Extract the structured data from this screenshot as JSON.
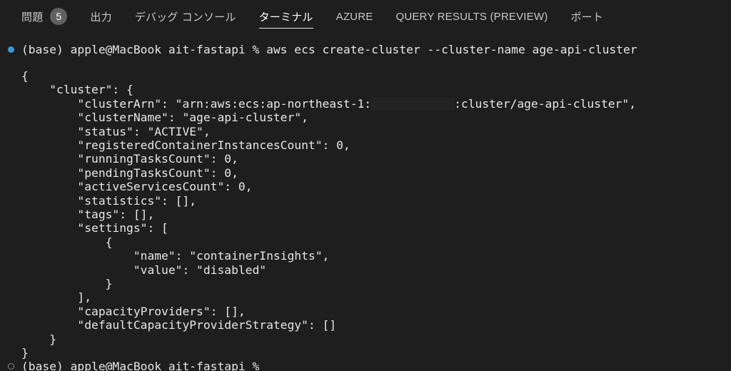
{
  "panel_tabs": [
    {
      "label": "問題",
      "badge": "5"
    },
    {
      "label": "出力"
    },
    {
      "label": "デバッグ コンソール"
    },
    {
      "label": "ターミナル",
      "active": true
    },
    {
      "label": "AZURE"
    },
    {
      "label": "QUERY RESULTS (PREVIEW)"
    },
    {
      "label": "ポート"
    }
  ],
  "terminal": {
    "command_prompt": "(base) apple@MacBook ait-fastapi % aws ecs create-cluster --cluster-name age-api-cluster",
    "output": {
      "l0": "{",
      "l1": "    \"cluster\": {",
      "l2_pre": "        \"clusterArn\": \"arn:aws:ecs:ap-northeast-1:",
      "l2_post": ":cluster/age-api-cluster\",",
      "l3": "        \"clusterName\": \"age-api-cluster\",",
      "l4": "        \"status\": \"ACTIVE\",",
      "l5": "        \"registeredContainerInstancesCount\": 0,",
      "l6": "        \"runningTasksCount\": 0,",
      "l7": "        \"pendingTasksCount\": 0,",
      "l8": "        \"activeServicesCount\": 0,",
      "l9": "        \"statistics\": [],",
      "l10": "        \"tags\": [],",
      "l11": "        \"settings\": [",
      "l12": "            {",
      "l13": "                \"name\": \"containerInsights\",",
      "l14": "                \"value\": \"disabled\"",
      "l15": "            }",
      "l16": "        ],",
      "l17": "        \"capacityProviders\": [],",
      "l18": "        \"defaultCapacityProviderStrategy\": []",
      "l19": "    }",
      "l20": "}"
    },
    "next_prompt": "(base) apple@MacBook ait-fastapi %"
  },
  "colors": {
    "background": "#1e1e1e",
    "prompt_dot_success": "#3c9ad7",
    "badge": "#616161"
  }
}
